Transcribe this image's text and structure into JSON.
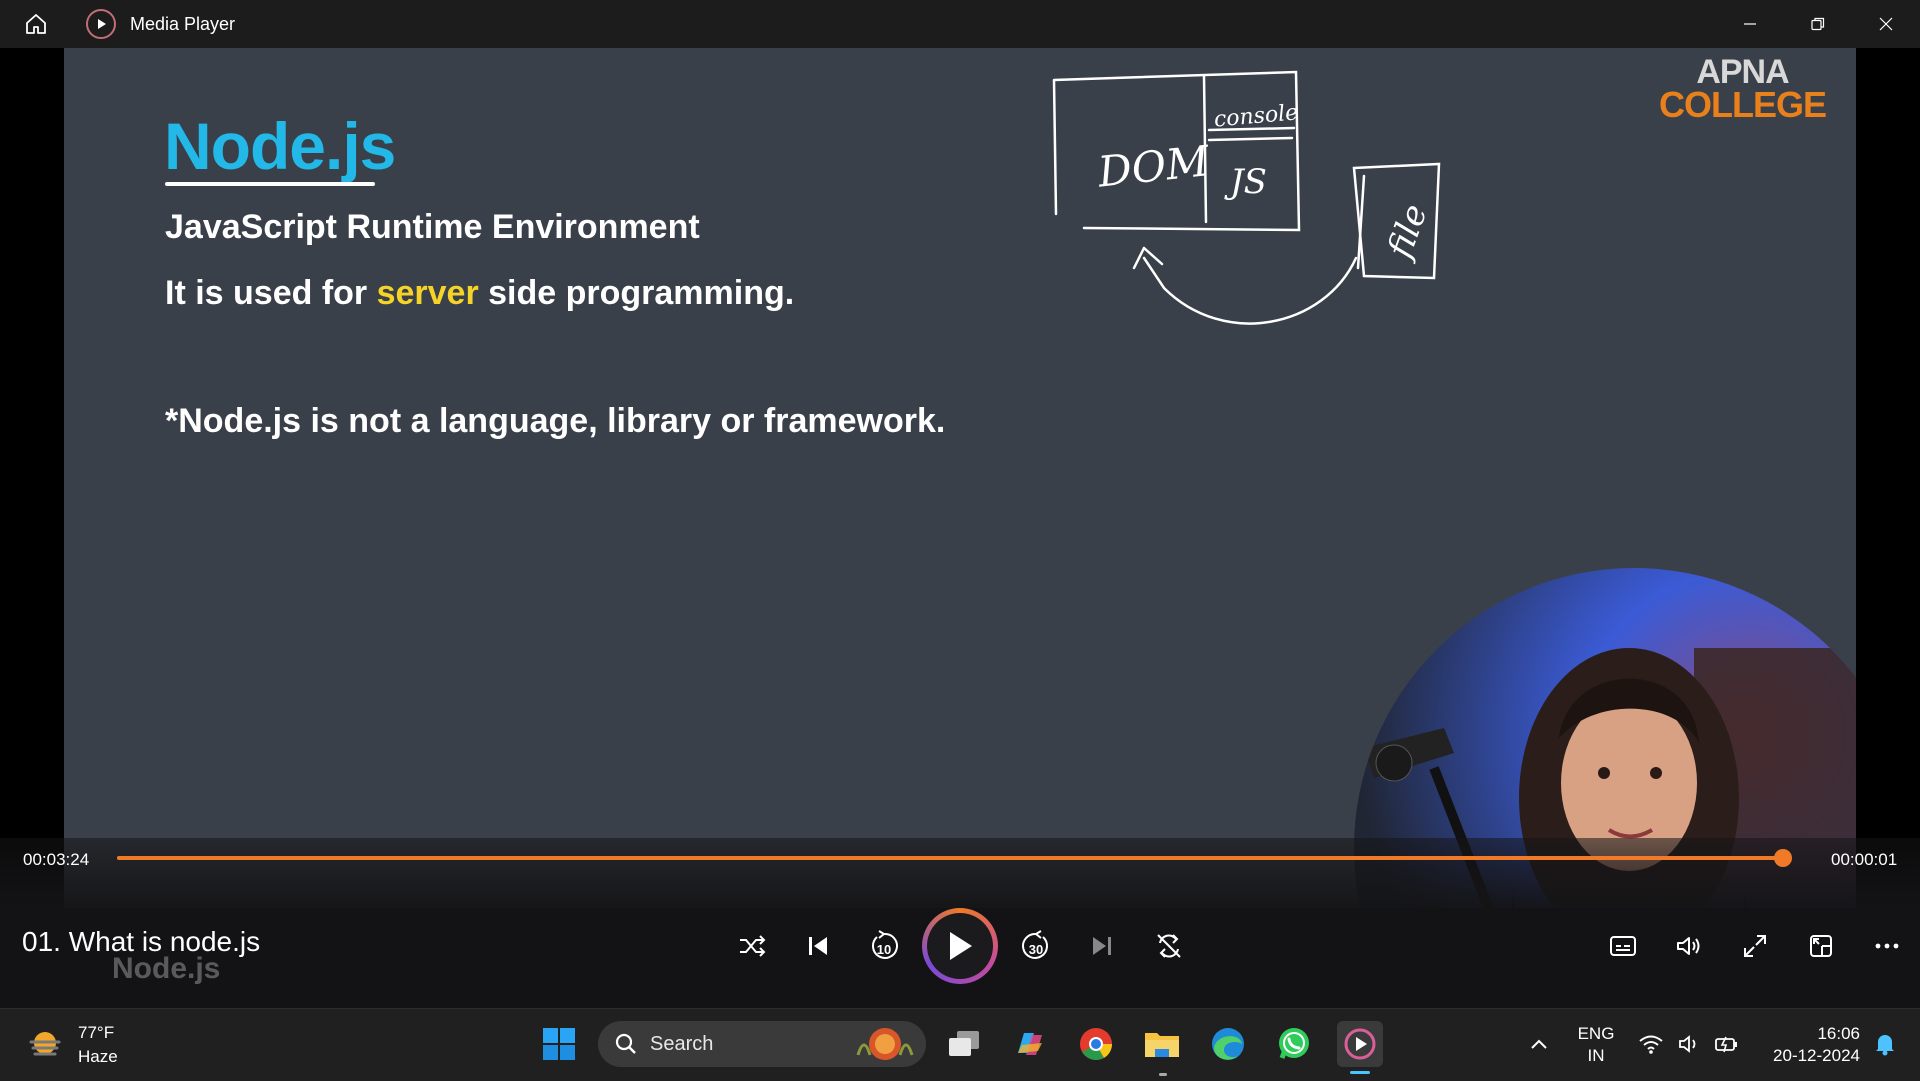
{
  "titlebar": {
    "title": "Media Player",
    "icons": [
      "home-icon",
      "media-player-icon",
      "minimize-icon",
      "restore-icon",
      "close-icon"
    ]
  },
  "slide": {
    "title": "Node.js",
    "subtitle": "JavaScript Runtime Environment",
    "line2_pre": "It is used for ",
    "line2_highlight": "server",
    "line2_post": " side programming.",
    "note": "*Node.js is not a language, library or framework.",
    "sketch": {
      "dom_label": "DOM",
      "console_label": "console",
      "js_label": "JS",
      "file_label": "file"
    },
    "logo_line1": "APNA",
    "logo_line2": "COLLEGE",
    "highlight_color": "#f5d328",
    "title_color": "#22b8e8"
  },
  "player": {
    "elapsed": "00:03:24",
    "remaining": "00:00:01",
    "progress_fraction": 0.995,
    "accent_color": "#f07a28",
    "track_title": "01. What is node.js",
    "ghost_caption": "Node.js",
    "controls": [
      "shuffle-icon",
      "previous-icon",
      "skip-back-10-icon",
      "play-icon",
      "skip-forward-30-icon",
      "next-icon",
      "repeat-icon"
    ],
    "skip_back_label": "10",
    "skip_forward_label": "30",
    "right_controls": [
      "subtitles-icon",
      "volume-icon",
      "fullscreen-icon",
      "miniplayer-icon",
      "more-icon"
    ]
  },
  "taskbar": {
    "weather_temp": "77°F",
    "weather_cond": "Haze",
    "search_label": "Search",
    "apps": [
      "windows-start-icon",
      "task-view-icon",
      "copilot-icon",
      "chrome-icon",
      "file-explorer-icon",
      "edge-icon",
      "whatsapp-icon",
      "media-player-icon"
    ],
    "lang_line1": "ENG",
    "lang_line2": "IN",
    "time": "16:06",
    "date": "20-12-2024"
  }
}
